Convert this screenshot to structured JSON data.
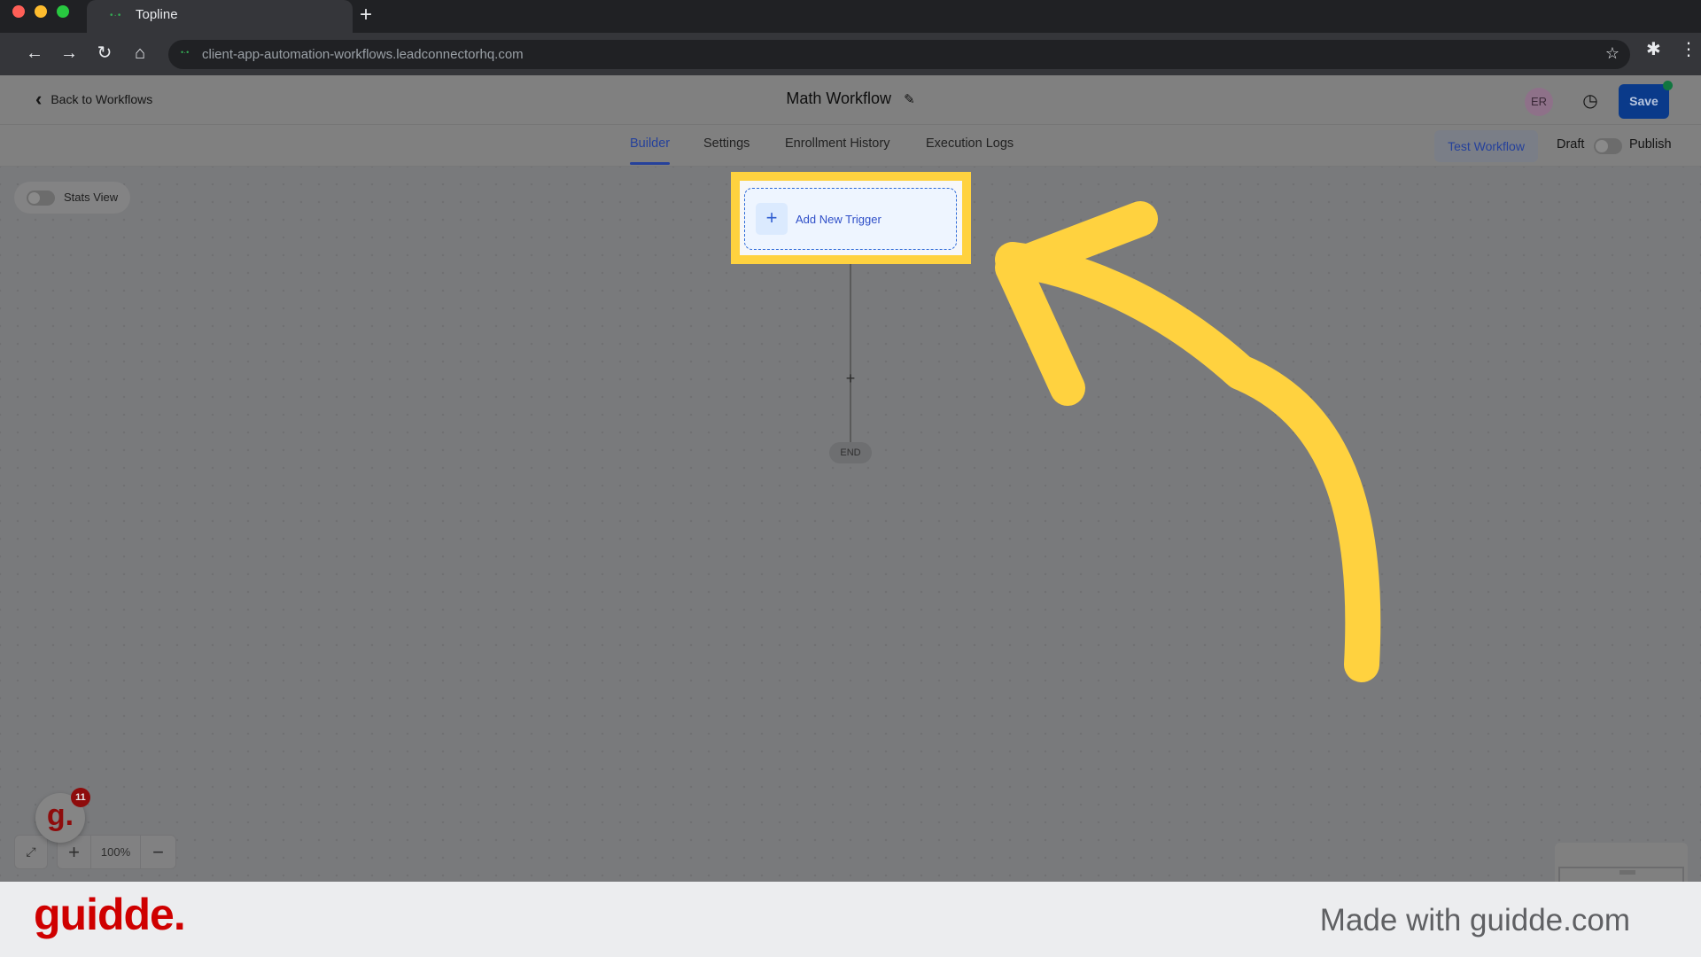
{
  "browser": {
    "tab_title": "Topline",
    "url": "client-app-automation-workflows.leadconnectorhq.com",
    "new_tab_icon": "+",
    "nav_icons": {
      "back": "←",
      "forward": "→",
      "reload": "↻",
      "home": "⌂",
      "star": "☆",
      "extensions": "✱",
      "menu": "⋮"
    }
  },
  "header": {
    "back_label": "Back to Workflows",
    "workflow_title": "Math Workflow",
    "avatar_initials": "ER",
    "save_label": "Save",
    "save_status_color": "#10763f"
  },
  "tabs": [
    {
      "label": "Builder",
      "active": true
    },
    {
      "label": "Settings",
      "active": false
    },
    {
      "label": "Enrollment History",
      "active": false
    },
    {
      "label": "Execution Logs",
      "active": false
    }
  ],
  "actions": {
    "test_workflow_label": "Test Workflow",
    "draft_label": "Draft",
    "publish_label": "Publish",
    "published": false
  },
  "canvas": {
    "stats_view_label": "Stats View",
    "stats_view_on": false,
    "trigger_label": "Add New Trigger",
    "add_step_icon": "+",
    "end_label": "END",
    "zoom_level": "100%",
    "zoom_in_icon": "+",
    "zoom_out_icon": "−",
    "fit_icon": "⤢"
  },
  "overlay": {
    "guidde_badge_letter": "g.",
    "guidde_badge_count": "11",
    "highlight_color": "#ffd23f",
    "arrow_color": "#ffd23f"
  },
  "footer": {
    "brand": "guidde.",
    "made_with": "Made with guidde.com",
    "brand_color": "#cf0000"
  }
}
